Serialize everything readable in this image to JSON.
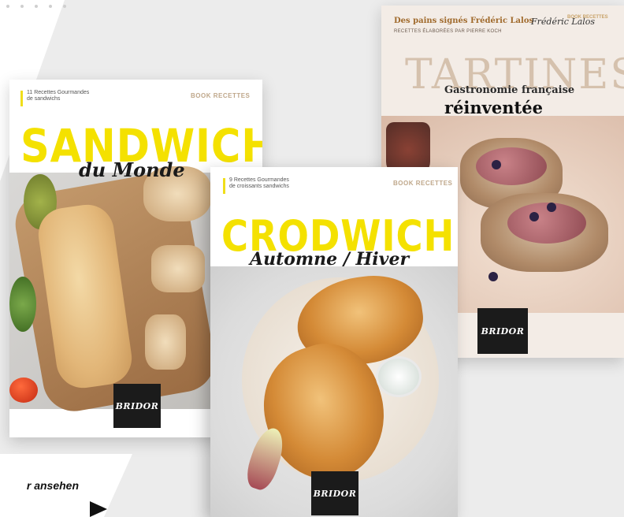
{
  "tartines": {
    "top_line": "Des pains signés Frédéric Lalos",
    "top_sub": "RECETTES ÉLABORÉES PAR PIERRE KOCH",
    "signature": "Frédéric Lalos",
    "brand_tag": "BOOK RECETTES",
    "title": "TARTINES",
    "subtitle1": "Gastronomie française",
    "subtitle2": "réinventée",
    "logo": "BRIDOR"
  },
  "sandwich": {
    "small_text": "11 Recettes Gourmandes\nde sandwichs",
    "book_label": "BOOK RECETTES",
    "title": "SANDWICH",
    "subtitle": "du Monde",
    "logo": "BRIDOR"
  },
  "crodwich": {
    "small_text": "9 Recettes Gourmandes\nde croissants sandwichs",
    "book_label": "BOOK RECETTES",
    "title": "CRODWICH",
    "subtitle": "Automne / Hiver",
    "logo": "BRIDOR"
  },
  "cta": {
    "label": "r ansehen"
  },
  "colors": {
    "accent_yellow": "#f4e100",
    "logo_bg": "#1b1b1b",
    "background": "#ececec"
  }
}
